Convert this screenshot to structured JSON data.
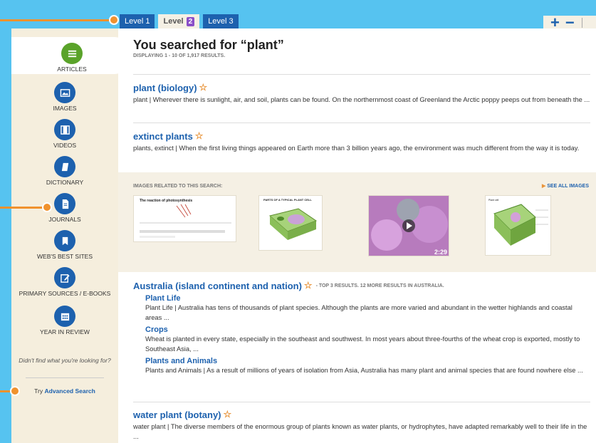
{
  "tabs": [
    {
      "label": "Level 1"
    },
    {
      "label": "Level",
      "badge": "2"
    },
    {
      "label": "Level 3"
    }
  ],
  "zoom": {
    "plus": "+",
    "minus": "−"
  },
  "sidebar": {
    "items": [
      {
        "label": "ARTICLES",
        "icon": "list-icon"
      },
      {
        "label": "IMAGES",
        "icon": "image-icon"
      },
      {
        "label": "VIDEOS",
        "icon": "film-icon"
      },
      {
        "label": "DICTIONARY",
        "icon": "book-icon"
      },
      {
        "label": "JOURNALS",
        "icon": "document-icon"
      },
      {
        "label": "WEB'S BEST SITES",
        "icon": "bookmark-icon"
      },
      {
        "label": "PRIMARY SOURCES / E-BOOKS",
        "icon": "edit-icon"
      },
      {
        "label": "YEAR IN REVIEW",
        "icon": "calendar-icon"
      }
    ],
    "note": "Didn't find what you're looking for?",
    "adv_prefix": "Try",
    "adv_link": "Advanced Search"
  },
  "main": {
    "title": "You searched for “plant”",
    "subtitle": "DISPLAYING 1 - 10 OF 1,917 RESULTS.",
    "results": [
      {
        "title": "plant (biology)",
        "desc": "plant  |  Wherever there is sunlight, air, and soil, plants can be found. On the northernmost coast of Greenland the Arctic poppy peeps out from beneath the ..."
      },
      {
        "title": "extinct plants",
        "desc": "plants, extinct  |  When the first living things appeared on Earth more than 3 billion years ago, the environment was much different from the way it is today."
      }
    ],
    "images_label": "IMAGES RELATED TO THIS SEARCH:",
    "see_all": "SEE ALL IMAGES",
    "images": [
      {
        "title": "The reaction of photosynthesis"
      },
      {
        "title": "PARTS OF A TYPICAL PLANT CELL"
      },
      {
        "duration": "2:29"
      },
      {
        "title": "Plant cell"
      }
    ],
    "australia": {
      "title": "Australia (island continent and nation)",
      "meta": "- TOP 3 RESULTS. 12 MORE RESULTS IN AUSTRALIA.",
      "subs": [
        {
          "title": "Plant Life",
          "desc": "Plant Life  |  Australia has tens of thousands of plant species. Although the plants are more varied and abundant in the wetter highlands and coastal areas ..."
        },
        {
          "title": "Crops",
          "desc": "Wheat is planted in every state, especially in the southeast and southwest. In most years about three-fourths of the wheat crop is exported, mostly to Southeast Asia, ..."
        },
        {
          "title": "Plants and Animals",
          "desc": "Plants and Animals  |  As a result of millions of years of isolation from Asia, Australia has many plant and animal species that are found nowhere else ..."
        }
      ]
    },
    "water": {
      "title": "water plant (botany)",
      "desc": "water plant  |  The diverse members of the enormous group of plants known as water plants, or hydrophytes, have adapted remarkably well to their life in the ..."
    }
  },
  "colors": {
    "accent": "#1d61ae",
    "active_green": "#5aa32a",
    "annotation": "#f0922e",
    "background": "#56c3f0"
  }
}
